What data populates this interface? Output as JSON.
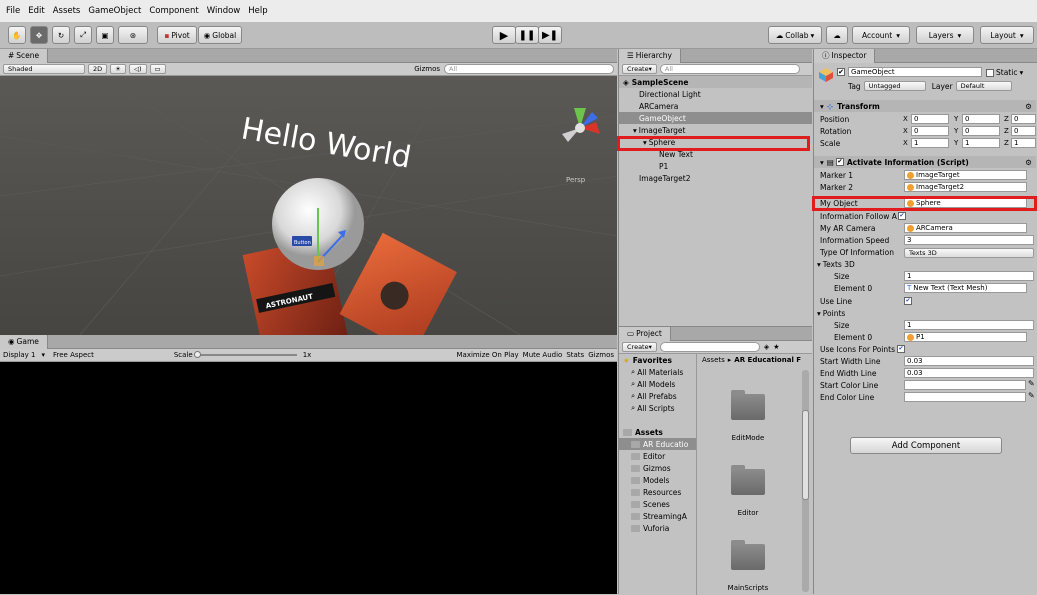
{
  "menu": [
    "File",
    "Edit",
    "Assets",
    "GameObject",
    "Component",
    "Window",
    "Help"
  ],
  "toolbar": {
    "pivot": "Pivot",
    "global": "Global",
    "collab": "Collab",
    "account": "Account",
    "layers": "Layers",
    "layout": "Layout"
  },
  "scene": {
    "tab": "Scene",
    "shaded": "Shaded",
    "mode2d": "2D",
    "gizmos": "Gizmos",
    "search_placeholder": "All",
    "hello": "Hello World",
    "persp": "Persp",
    "button_label": "Button",
    "card_text": "ASTRONAUT"
  },
  "game": {
    "tab": "Game",
    "display": "Display 1",
    "aspect": "Free Aspect",
    "scale_label": "Scale",
    "scale_value": "1x",
    "maximize": "Maximize On Play",
    "mute": "Mute Audio",
    "stats": "Stats",
    "gizmos": "Gizmos"
  },
  "hierarchy": {
    "tab": "Hierarchy",
    "create": "Create",
    "search_placeholder": "All",
    "scene": "SampleScene",
    "items": [
      "Directional Light",
      "ARCamera",
      "GameObject",
      "ImageTarget",
      "Sphere",
      "New Text",
      "P1",
      "ImageTarget2"
    ]
  },
  "project": {
    "tab": "Project",
    "create": "Create",
    "breadcrumb_root": "Assets",
    "breadcrumb_current": "AR Educational F",
    "favorites": "Favorites",
    "fav_items": [
      "All Materials",
      "All Models",
      "All Prefabs",
      "All Scripts"
    ],
    "assets": "Assets",
    "asset_items": [
      "AR Educatio",
      "Editor",
      "Gizmos",
      "Models",
      "Resources",
      "Scenes",
      "StreamingA",
      "Vuforia"
    ],
    "folders": [
      "EditMode",
      "Editor",
      "MainScripts"
    ]
  },
  "inspector": {
    "tab": "Inspector",
    "name": "GameObject",
    "static": "Static",
    "tag_label": "Tag",
    "tag_value": "Untagged",
    "layer_label": "Layer",
    "layer_value": "Default",
    "transform": {
      "title": "Transform",
      "position": "Position",
      "rotation": "Rotation",
      "scale": "Scale",
      "pos": [
        "0",
        "0",
        "0"
      ],
      "rot": [
        "0",
        "0",
        "0"
      ],
      "scl": [
        "1",
        "1",
        "1"
      ]
    },
    "script": {
      "title": "Activate Information (Script)",
      "marker1_label": "Marker 1",
      "marker1": "ImageTarget",
      "marker2_label": "Marker 2",
      "marker2": "ImageTarget2",
      "myobject_label": "My Object",
      "myobject": "Sphere",
      "follow_label": "Information Follow A",
      "camera_label": "My AR Camera",
      "camera": "ARCamera",
      "speed_label": "Information Speed",
      "speed": "3",
      "type_label": "Type Of Information",
      "type": "Texts 3D",
      "texts_label": "Texts 3D",
      "size_label": "Size",
      "texts_size": "1",
      "element0_label": "Element 0",
      "texts_element0": "New Text (Text Mesh)",
      "useline_label": "Use Line",
      "points_label": "Points",
      "points_size": "1",
      "points_element0": "P1",
      "useicons_label": "Use Icons For Points",
      "startwidth_label": "Start Width Line",
      "startwidth": "0.03",
      "endwidth_label": "End Width Line",
      "endwidth": "0.03",
      "startcolor_label": "Start Color Line",
      "endcolor_label": "End Color Line"
    },
    "add_component": "Add Component"
  },
  "colors": {
    "highlight": "#e01c1c",
    "selection": "#3d6fb5",
    "scene_bg": "#4d4c49"
  }
}
